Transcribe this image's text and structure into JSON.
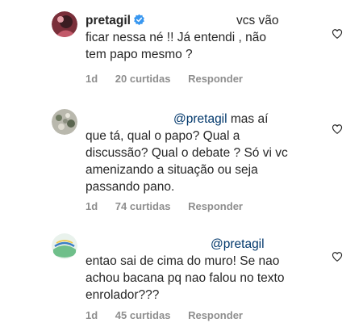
{
  "comments": [
    {
      "username": "pretagil",
      "verified": true,
      "lines": [
        "vcs vão",
        "ficar nessa né !! Já entendi , não",
        "tem papo mesmo ?"
      ],
      "age": "1d",
      "likes": "20 curtidas",
      "reply_label": "Responder"
    },
    {
      "mention": "@pretagil",
      "lines": [
        "mas aí",
        "que tá, qual o papo? Qual a",
        "discussão? Qual o debate ? Só vi vc",
        "amenizando a situação ou seja",
        "passando pano."
      ],
      "age": "1d",
      "likes": "74 curtidas",
      "reply_label": "Responder"
    },
    {
      "mention": "@pretagil",
      "lines": [
        "entao sai de cima do muro!  Se nao",
        "achou bacana pq nao falou no texto",
        "enrolador???"
      ],
      "age": "1d",
      "likes": "45 curtidas",
      "reply_label": "Responder"
    }
  ],
  "icons": {
    "like": "heart-outline-icon",
    "verified": "verified-badge-icon"
  },
  "colors": {
    "text": "#262626",
    "meta": "#8e8e8e",
    "mention": "#00376b",
    "verified": "#3897f0"
  }
}
